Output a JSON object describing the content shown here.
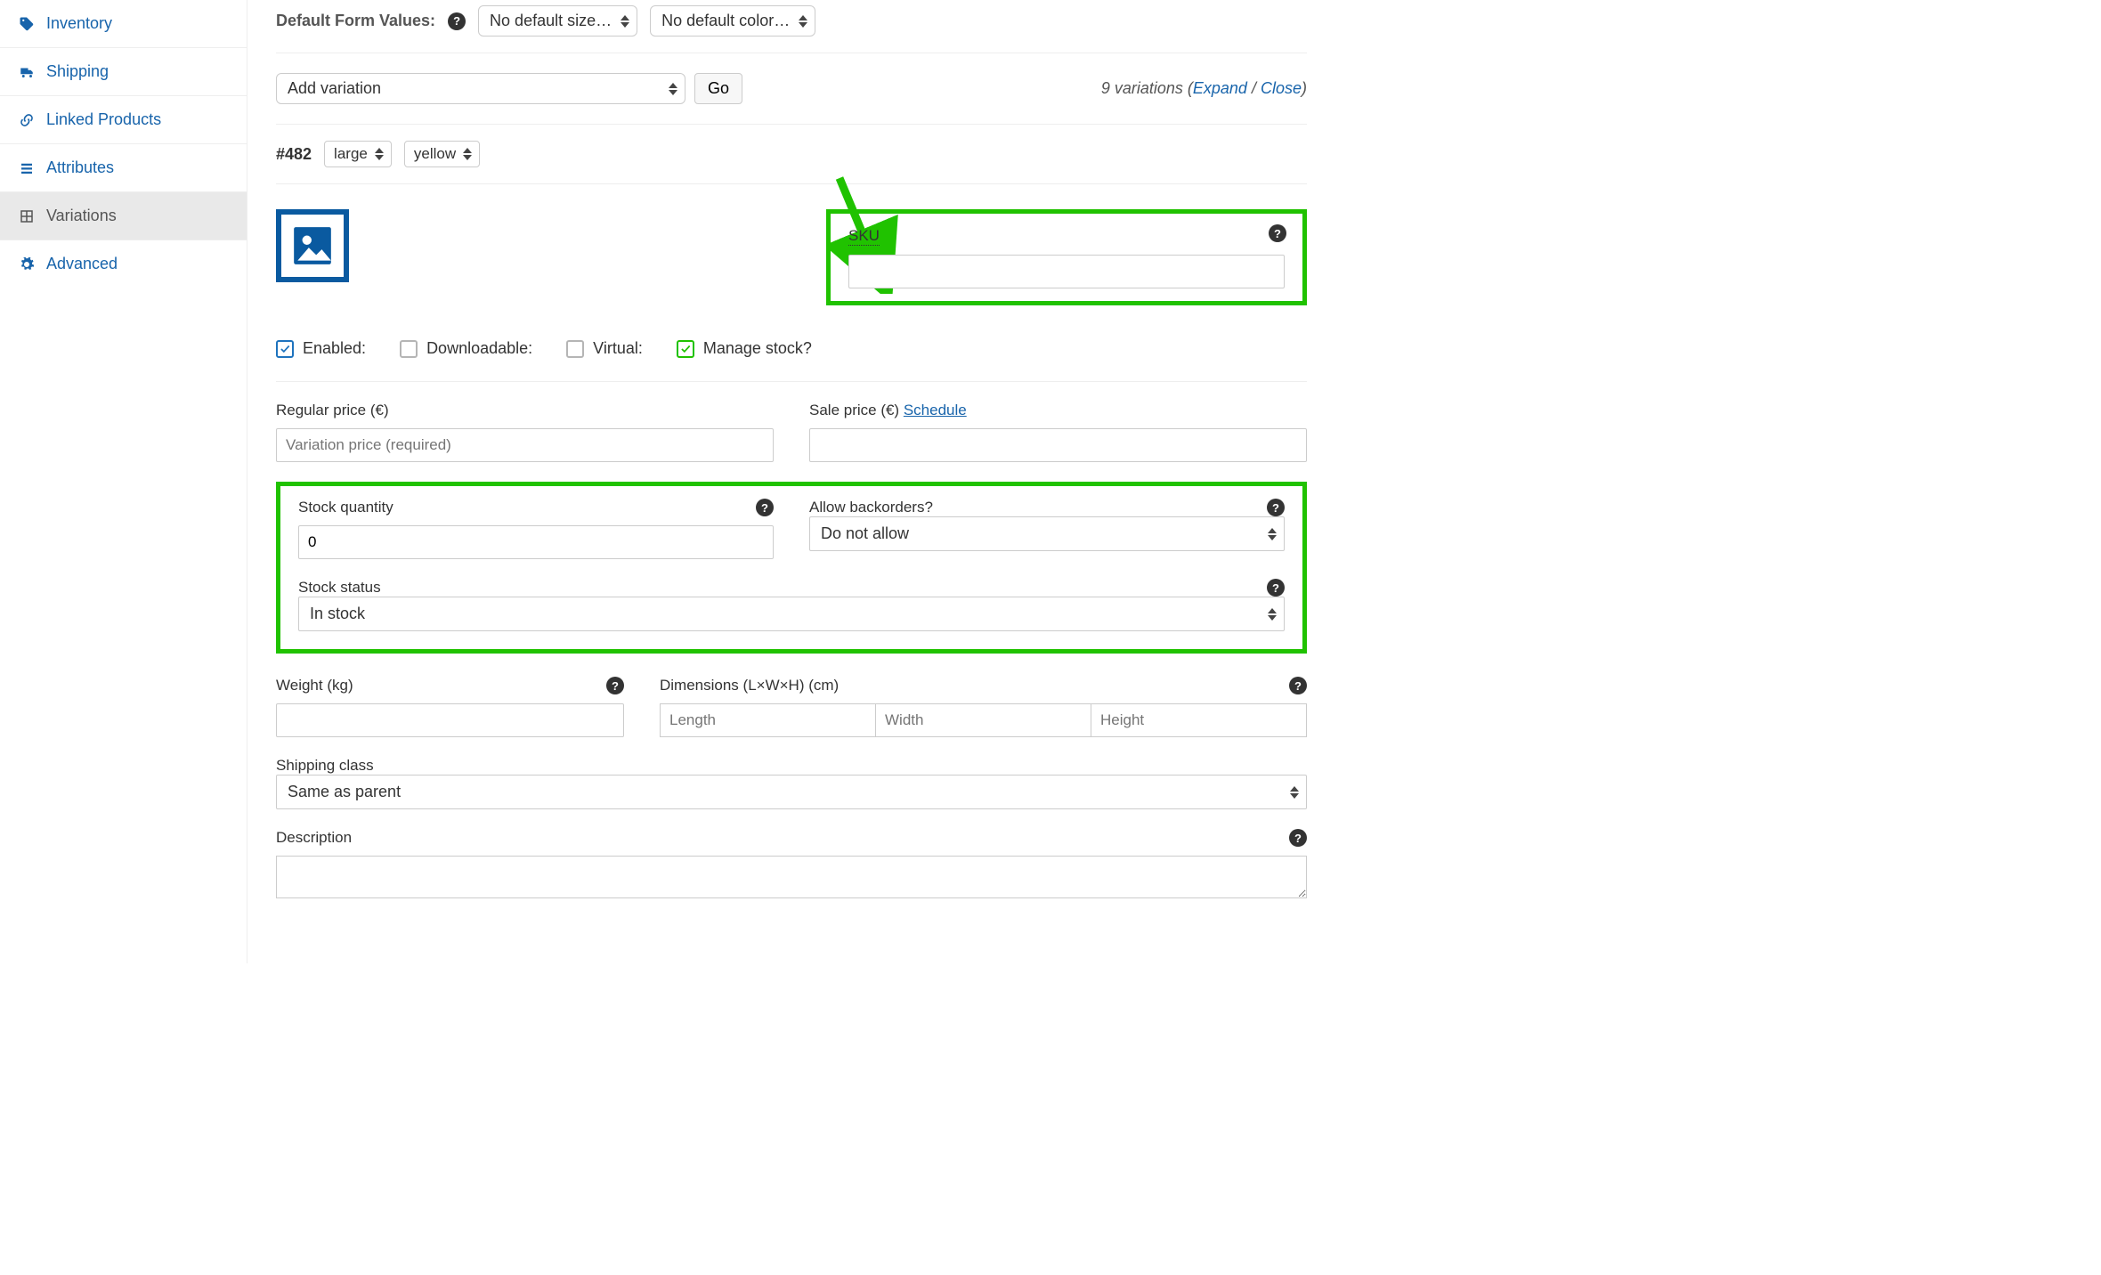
{
  "sidebar": {
    "items": [
      {
        "label": "Inventory",
        "icon": "inventory"
      },
      {
        "label": "Shipping",
        "icon": "shipping"
      },
      {
        "label": "Linked Products",
        "icon": "linked"
      },
      {
        "label": "Attributes",
        "icon": "attributes"
      },
      {
        "label": "Variations",
        "icon": "variations"
      },
      {
        "label": "Advanced",
        "icon": "advanced"
      }
    ]
  },
  "default_values": {
    "label": "Default Form Values:",
    "size": "No default size…",
    "color": "No default color…"
  },
  "add_variation": {
    "select": "Add variation",
    "button": "Go"
  },
  "variations_summary": {
    "count": "9 variations",
    "open_paren": " (",
    "expand": "Expand",
    "sep": " / ",
    "close": "Close",
    "close_paren": ")"
  },
  "variation": {
    "id": "#482",
    "size": "large",
    "color": "yellow",
    "sku_label": "SKU",
    "checks": {
      "enabled": "Enabled:",
      "downloadable": "Downloadable:",
      "virtual": "Virtual:",
      "manage": "Manage stock?"
    },
    "regular_price_label": "Regular price (€)",
    "regular_price_placeholder": "Variation price (required)",
    "sale_price_label": "Sale price (€) ",
    "schedule": "Schedule",
    "stock_qty_label": "Stock quantity",
    "stock_qty_value": "0",
    "backorders_label": "Allow backorders?",
    "backorders_value": "Do not allow",
    "stock_status_label": "Stock status",
    "stock_status_value": "In stock",
    "weight_label": "Weight (kg)",
    "dims_label": "Dimensions (L×W×H) (cm)",
    "dim_length": "Length",
    "dim_width": "Width",
    "dim_height": "Height",
    "shipping_class_label": "Shipping class",
    "shipping_class_value": "Same as parent",
    "desc_label": "Description"
  }
}
